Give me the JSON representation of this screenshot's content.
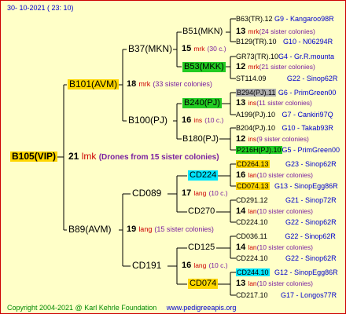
{
  "header": {
    "date": "30- 10-2021 ( 23: 10)"
  },
  "footer": {
    "copyright": "Copyright 2004-2021 @ Karl Kehrle Foundation",
    "url": "www.pedigreeapis.org"
  },
  "colors": {
    "background": "#ffffc8",
    "border": "#cc0000",
    "gold": "#ffd700",
    "green": "#22cc22",
    "cyan": "#00e5ff",
    "gray": "#b0b0b0",
    "blue_text": "#0000cc",
    "red_text": "#cc0000",
    "purple_text": "#7a1fa0"
  },
  "root": {
    "name": "B105(VIP)",
    "year": "21",
    "mark": "lmk",
    "note": "(Drones from 15 sister colonies)"
  },
  "gen1": [
    {
      "name": "B101(AVM)",
      "year": "18",
      "mark": "mrk",
      "note": "(33 sister colonies)"
    },
    {
      "name": "B89(AVM)",
      "year": "19",
      "mark": "lang",
      "note": "(15 sister colonies)"
    }
  ],
  "gen2": [
    {
      "name": "B37(MKN)",
      "year": "15",
      "mark": "mrk",
      "note": "(30 c.)"
    },
    {
      "name": "B100(PJ)",
      "year": "16",
      "mark": "ins",
      "note": "(10 c.)"
    },
    {
      "name": "CD089",
      "year": "17",
      "mark": "lang",
      "note": "(10 c.)"
    },
    {
      "name": "CD191",
      "year": "16",
      "mark": "lang",
      "note": "(10 c.)"
    }
  ],
  "gen3": [
    {
      "name": "B51(MKN)",
      "year": "13",
      "mark": "mrk",
      "note": "(24 sister colonies)"
    },
    {
      "name": "B53(MKK)",
      "year": "12",
      "mark": "mrk",
      "note": "(21 sister colonies)"
    },
    {
      "name": "B240(PJ)",
      "year": "13",
      "mark": "ins",
      "note": "(11 sister colonies)"
    },
    {
      "name": "B180(PJ)",
      "year": "12",
      "mark": "ins",
      "note": "(9 sister colonies)"
    },
    {
      "name": "CD224",
      "year": "16",
      "mark": "lan",
      "note": "(10 sister colonies)"
    },
    {
      "name": "CD270",
      "year": "14",
      "mark": "lan",
      "note": "(10 sister colonies)"
    },
    {
      "name": "CD125",
      "year": "14",
      "mark": "lan",
      "note": "(10 sister colonies)"
    },
    {
      "name": "CD074",
      "year": "13",
      "mark": "lan",
      "note": "(10 sister colonies)"
    }
  ],
  "gen4": [
    {
      "name": "B63(TR).12",
      "tag": "G9 - Kangaroo98R"
    },
    {
      "name": "B129(TR).10",
      "tag": "G10 - N06294R"
    },
    {
      "name": "GR73(TR).10",
      "tag": "G4 - Gr.R.mounta"
    },
    {
      "name": "ST114.09",
      "tag": "G22 - Sinop62R"
    },
    {
      "name": "B294(PJ).11",
      "tag": "G6 - PrimGreen00"
    },
    {
      "name": "A199(PJ).10",
      "tag": "G7 - Cankiri97Q"
    },
    {
      "name": "B204(PJ).10",
      "tag": "G10 - Takab93R"
    },
    {
      "name": "P216H(PJ).10",
      "tag": "G5 - PrimGreen00"
    },
    {
      "name": "CD264.13",
      "tag": "G23 - Sinop62R"
    },
    {
      "name": "CD074.13",
      "tag": "G13 - SinopEgg86R"
    },
    {
      "name": "CD291.12",
      "tag": "G21 - Sinop72R"
    },
    {
      "name": "CD224.10",
      "tag": "G22 - Sinop62R"
    },
    {
      "name": "CD036.11",
      "tag": "G22 - Sinop62R"
    },
    {
      "name": "CD224.10",
      "tag": "G22 - Sinop62R"
    },
    {
      "name": "CD244.10",
      "tag": "G12 - SinopEgg86R"
    },
    {
      "name": "CD217.10",
      "tag": "G17 - Longos77R"
    }
  ]
}
